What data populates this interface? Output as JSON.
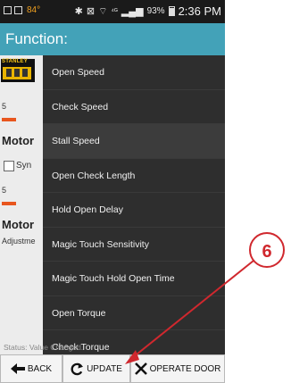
{
  "statusbar": {
    "temperature": "84°",
    "signal_text": "⁴ᴳ",
    "battery_pct": "93%",
    "time": "2:36 PM"
  },
  "titlebar": {
    "title": "Function:"
  },
  "background": {
    "logo_text": "STANLEY",
    "value_1": "5",
    "motor_1": "Motor",
    "sync_label": "Syn",
    "value_2": "5",
    "motor_2": "Motor",
    "adjust_label": "Adjustme"
  },
  "menu": {
    "items": [
      {
        "label": "Open Speed"
      },
      {
        "label": "Check Speed"
      },
      {
        "label": "Stall Speed"
      },
      {
        "label": "Open Check Length"
      },
      {
        "label": "Hold Open Delay"
      },
      {
        "label": "Magic Touch Sensitivity"
      },
      {
        "label": "Magic Touch Hold Open Time"
      },
      {
        "label": "Open Torque"
      },
      {
        "label": "Check Torque"
      }
    ]
  },
  "status": {
    "text": "Status: Value Changed."
  },
  "bottombar": {
    "back_label": "BACK",
    "update_label": "UPDATE",
    "operate_label": "OPERATE DOOR"
  },
  "callout": {
    "number": "6",
    "color": "#d0282e"
  },
  "colors": {
    "title_bg": "#43a2b8",
    "menu_bg": "#2e2e2e"
  }
}
